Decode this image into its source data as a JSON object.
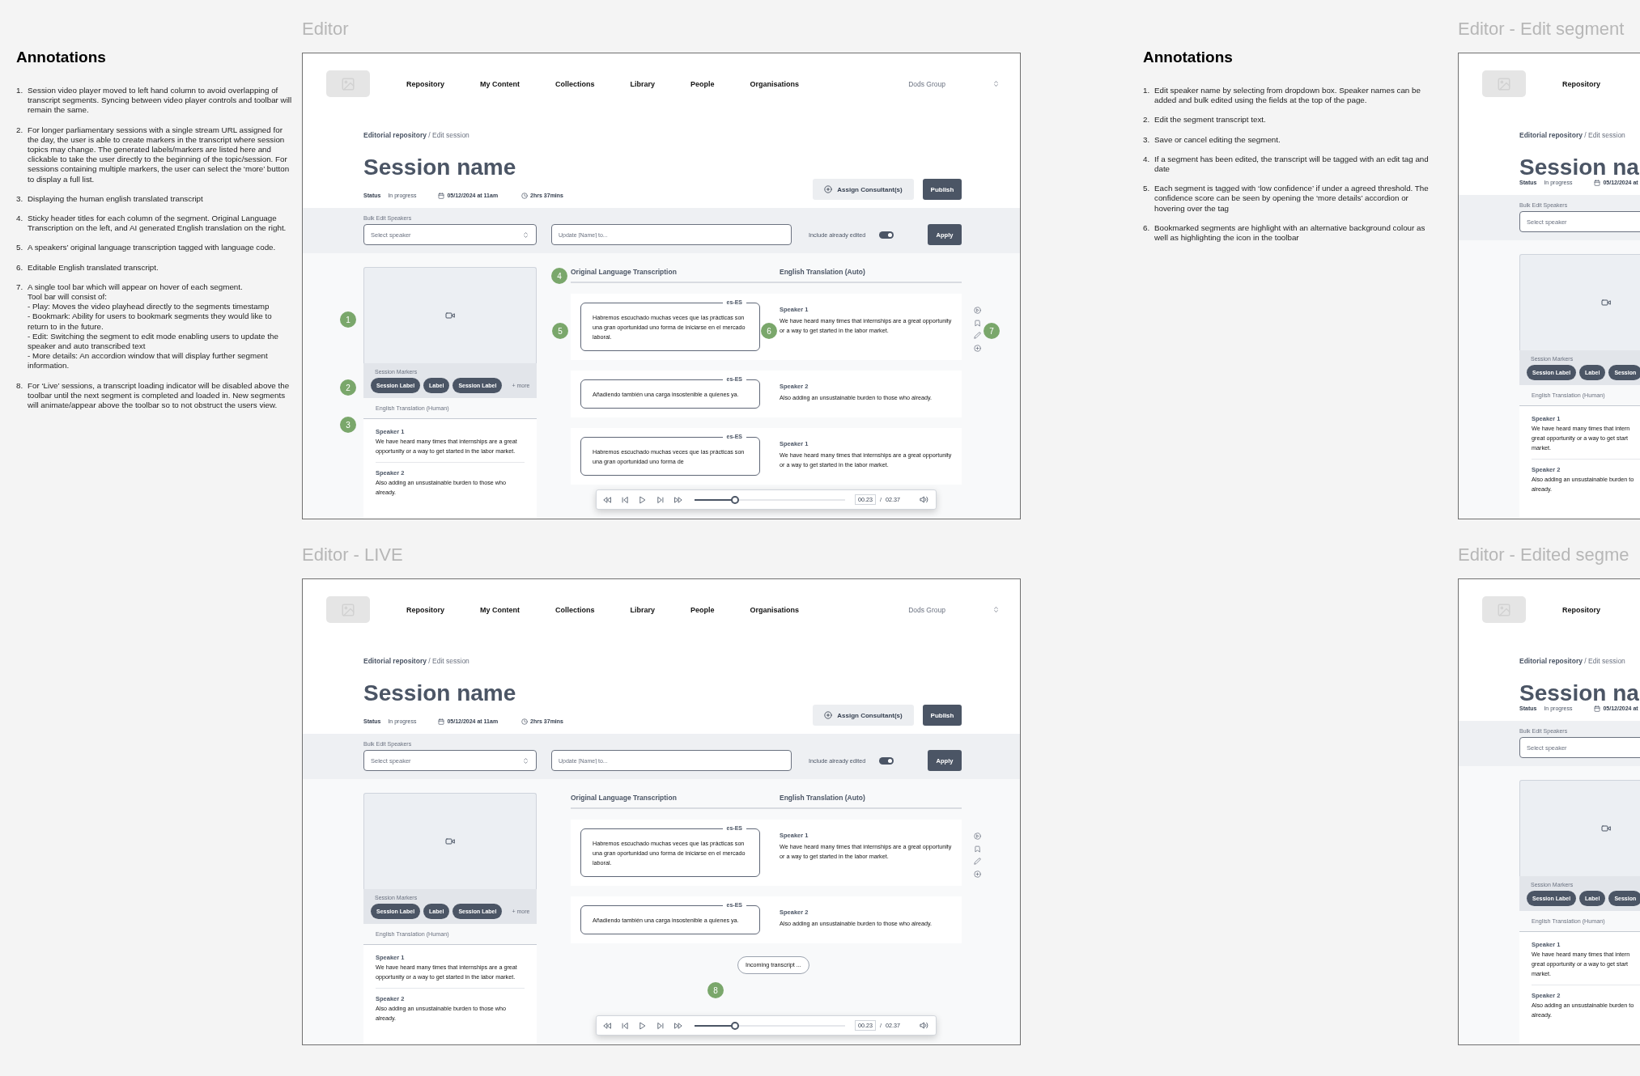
{
  "annotations": [
    {
      "title": "Annotations",
      "items": [
        {
          "number": "1.",
          "text": "Session video player moved to left hand column to avoid overlapping of transcript segments. Syncing between video player controls and toolbar will remain the same."
        },
        {
          "number": "2.",
          "text": "For longer parliamentary sessions with a single stream URL assigned for the day, the user is able to create markers in the transcript where session topics may change. The generated labels/markers are listed here and clickable to take the user directly to the beginning of the topic/session. For sessions containing multiple markers, the user can select the ‘more’ button to display a full list."
        },
        {
          "number": "3.",
          "text": "Displaying the human english translated transcript"
        },
        {
          "number": "4.",
          "text": "Sticky header titles for each column of the segment. Original Language Transcription on the left, and AI generated English translation on the right."
        },
        {
          "number": "5.",
          "text": "A speakers’ original language transcription tagged with language code."
        },
        {
          "number": "6.",
          "text": "Editable English translated transcript."
        },
        {
          "number": "7.",
          "text": "A single tool bar which will appear on hover of each segment.\nTool bar will consist of:\n- Play: Moves the video playhead directly to the segments timestamp\n- Bookmark: Ability for users to bookmark segments they would like to return to in the future.\n- Edit: Switching the segment to edit mode enabling users to update the speaker and auto transcribed text\n- More details: An accordion window that will display further segment information."
        },
        {
          "number": "8.",
          "text": "For ‘Live’ sessions, a transcript loading indicator will be disabled above the toolbar until the next segment is completed and loaded in. New segments will animate/appear above the toolbar so to not obstruct the users view."
        }
      ]
    },
    {
      "title": "Annotations",
      "items": [
        {
          "number": "1.",
          "text": "Edit speaker name by selecting from dropdown box. Speaker names can be added and bulk edited using the fields at the top of the page."
        },
        {
          "number": "2.",
          "text": "Edit the segment transcript text."
        },
        {
          "number": "3.",
          "text": "Save or cancel editing the segment."
        },
        {
          "number": "4.",
          "text": "If a segment has been edited, the transcript will be tagged with an edit tag and date"
        },
        {
          "number": "5.",
          "text": "Each segment is tagged with ‘low confidence’ if under a agreed threshold. The confidence score can be seen by opening the ‘more details’ accordion or hovering over the tag"
        },
        {
          "number": "6.",
          "text": "Bookmarked segments are highlight with an alternative background colour as well as highlighting the icon in the toolbar"
        }
      ]
    }
  ],
  "frames": [
    {
      "label": "Editor",
      "nav": {
        "items": [
          "Repository",
          "My Content",
          "Collections",
          "Library",
          "People",
          "Organisations"
        ],
        "account": "Dods Group"
      },
      "breadcrumb": "**Editorial repository** / Edit session",
      "title": "Session name",
      "status": {
        "label": "Status",
        "value": "In progress",
        "date": "05/12/2024 at 11am",
        "duration": "2hrs 37mins"
      },
      "actions": [
        {
          "label": "Assign Consultant(s)",
          "kind": "secondary"
        },
        {
          "label": "Publish",
          "kind": "primary"
        }
      ],
      "bulk": {
        "label": "Bulk Edit Speakers",
        "select_placeholder": "Select speaker",
        "update_placeholder": "Update [Name] to...",
        "toggle_label": "Include already edited",
        "toggle_on": true,
        "apply": "Apply"
      },
      "markers": {
        "title": "Session Markers",
        "chips": [
          "Session Label",
          "Label",
          "Session Label"
        ],
        "more": "+ more"
      },
      "human": {
        "title": "English Translation (Human)",
        "entries": [
          {
            "speaker": "Speaker 1",
            "text": "We have heard many times that internships are a great opportunity or a way to get started in the labor market."
          },
          {
            "speaker": "Speaker 2",
            "text": "Also adding an unsustainable burden to those who already."
          }
        ]
      },
      "columns": [
        "Original Language Transcription",
        "English Translation (Auto)"
      ],
      "segments": [
        {
          "lang": "es-ES",
          "original": "Habremos escuchado muchas veces que las prácticas son una gran oportunidad uno forma de iniciarse en el mercado laboral.",
          "speaker": "Speaker 1",
          "translation": "We have heard many times that internships are a great opportunity or a way to get started in the labor market.",
          "hovered": true
        },
        {
          "lang": "es-ES",
          "original": "Añadiendo también una carga insostenible a quienes ya.",
          "speaker": "Speaker 2",
          "translation": "Also adding an unsustainable burden to those who already.",
          "hovered": false
        },
        {
          "lang": "es-ES",
          "original": "Habremos escuchado muchas veces que las prácticas son una gran oportunidad uno forma de",
          "speaker": "Speaker 1",
          "translation": "We have heard many times that internships are a great opportunity or a way to get started in the labor market.",
          "hovered": false
        }
      ],
      "player": {
        "level": 0.27,
        "current": "00.23",
        "separator": "/",
        "total": "02.37"
      },
      "callouts": {
        "video": "1",
        "markers": "2",
        "human": "3",
        "columns": "4",
        "original": "5",
        "translation": "6",
        "toolbar": "7"
      }
    },
    {
      "label": "Editor - LIVE",
      "nav": {
        "items": [
          "Repository",
          "My Content",
          "Collections",
          "Library",
          "People",
          "Organisations"
        ],
        "account": "Dods Group"
      },
      "breadcrumb": "**Editorial repository** / Edit session",
      "title": "Session name",
      "status": {
        "label": "Status",
        "value": "In progress",
        "date": "05/12/2024 at 11am",
        "duration": "2hrs 37mins"
      },
      "actions": [
        {
          "label": "Assign Consultant(s)",
          "kind": "secondary"
        },
        {
          "label": "Publish",
          "kind": "primary"
        }
      ],
      "bulk": {
        "label": "Bulk Edit Speakers",
        "select_placeholder": "Select speaker",
        "update_placeholder": "Update [Name] to...",
        "toggle_label": "Include already edited",
        "toggle_on": true,
        "apply": "Apply"
      },
      "markers": {
        "title": "Session Markers",
        "chips": [
          "Session Label",
          "Label",
          "Session Label"
        ],
        "more": "+ more"
      },
      "human": {
        "title": "English Translation (Human)",
        "entries": [
          {
            "speaker": "Speaker 1",
            "text": "We have heard many times that internships are a great opportunity or a way to get started in the labor market."
          },
          {
            "speaker": "Speaker 2",
            "text": "Also adding an unsustainable burden to those who already."
          }
        ]
      },
      "columns": [
        "Original Language Transcription",
        "English Translation (Auto)"
      ],
      "segments": [
        {
          "lang": "es-ES",
          "original": "Habremos escuchado muchas veces que las prácticas son una gran oportunidad uno forma de iniciarse en el mercado laboral.",
          "speaker": "Speaker 1",
          "translation": "We have heard many times that internships are a great opportunity or a way to get started in the labor market.",
          "hovered": true
        },
        {
          "lang": "es-ES",
          "original": "Añadiendo también una carga insostenible a quienes ya.",
          "speaker": "Speaker 2",
          "translation": "Also adding an unsustainable burden to those who already.",
          "hovered": false
        }
      ],
      "incoming": "Incoming transcript ...",
      "player": {
        "level": 0.27,
        "current": "00.23",
        "separator": "/",
        "total": "02.37"
      },
      "callouts": {
        "incoming": "8"
      }
    },
    {
      "label": "Editor - Edit segment",
      "nav": {
        "items": [
          "Repository"
        ]
      },
      "breadcrumb": "**Editorial repository** / Edit session",
      "title": "Session na",
      "status": {
        "label": "Status",
        "value": "In progress",
        "date": "05/12/2024 at"
      },
      "bulk": {
        "label": "Bulk Edit Speakers",
        "select_placeholder": "Select speaker"
      },
      "markers": {
        "title": "Session Markers",
        "chips": [
          "Session Label",
          "Label",
          "Session"
        ]
      },
      "human": {
        "title": "English Translation (Human)",
        "entries": [
          {
            "speaker": "Speaker 1",
            "text": "We have heard many times that intern\ngreat opportunity or a way to get start\nmarket."
          },
          {
            "speaker": "Speaker 2",
            "text": "Also adding an unsustainable burden to\nalready."
          }
        ]
      }
    },
    {
      "label": "Editor - Edited segme",
      "nav": {
        "items": [
          "Repository"
        ]
      },
      "breadcrumb": "**Editorial repository** / Edit session",
      "title": "Session na",
      "status": {
        "label": "Status",
        "value": "In progress",
        "date": "05/12/2024 at"
      },
      "bulk": {
        "label": "Bulk Edit Speakers",
        "select_placeholder": "Select speaker"
      },
      "markers": {
        "title": "Session Markers",
        "chips": [
          "Session Label",
          "Label",
          "Session"
        ]
      },
      "human": {
        "title": "English Translation (Human)",
        "entries": [
          {
            "speaker": "Speaker 1",
            "text": "We have heard many times that intern\ngreat opportunity or a way to get start\nmarket."
          },
          {
            "speaker": "Speaker 2",
            "text": "Also adding an unsustainable burden to\nalready."
          }
        ]
      }
    }
  ]
}
